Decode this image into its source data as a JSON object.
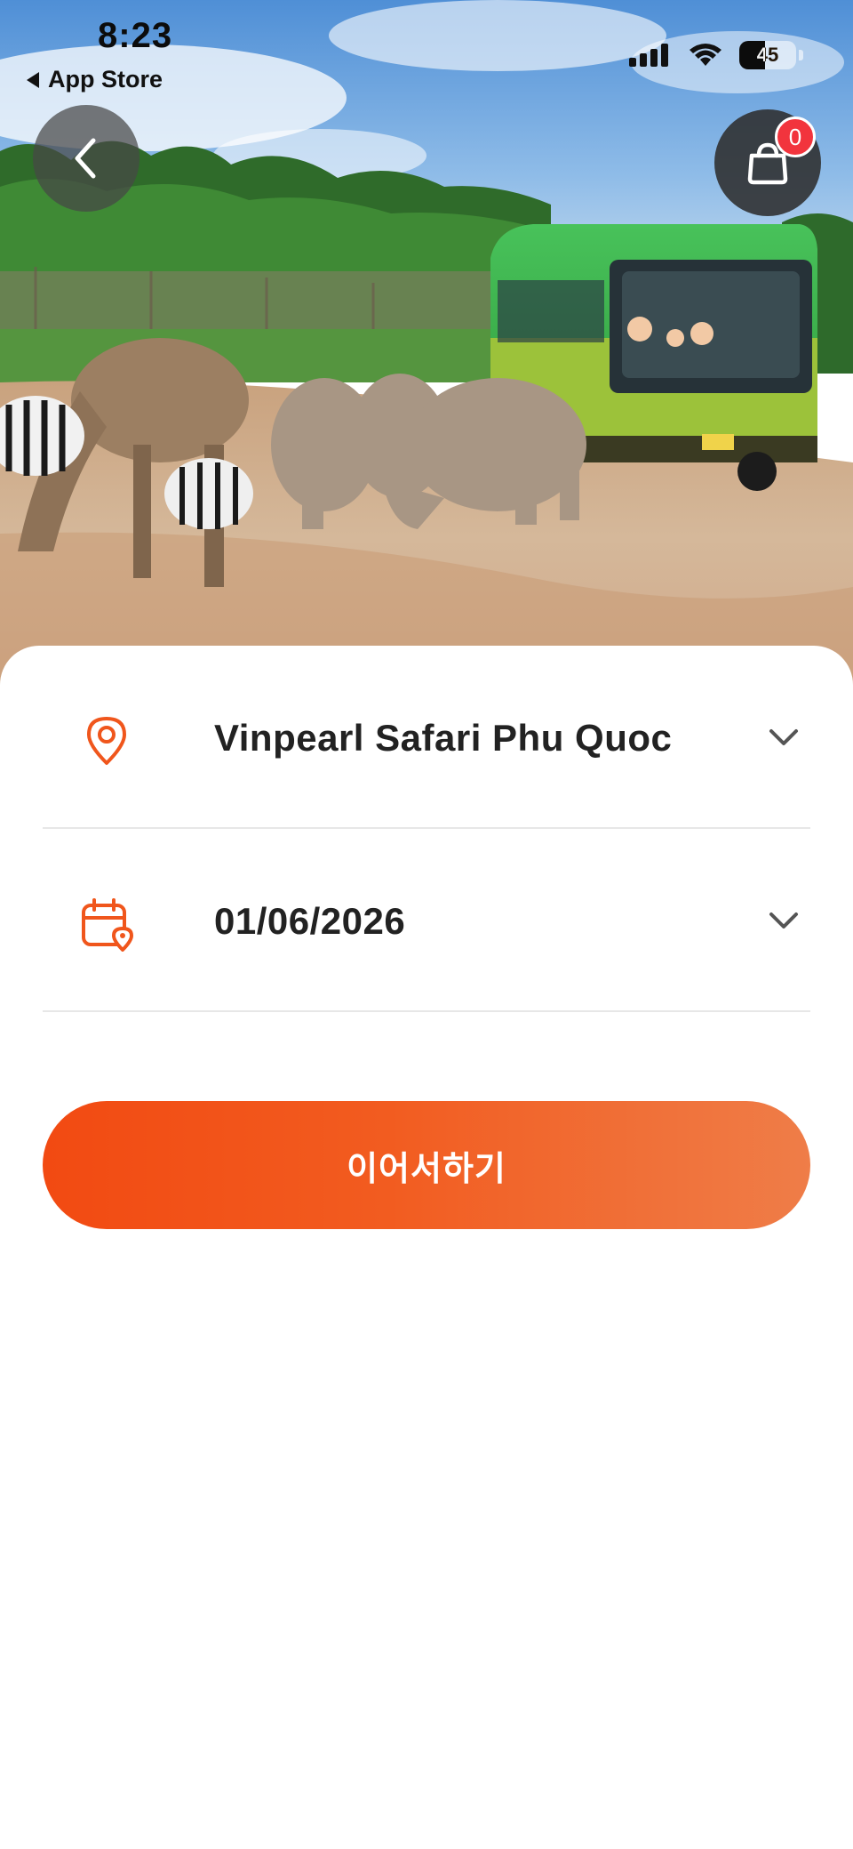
{
  "status_bar": {
    "time": "8:23",
    "back_app": "App Store",
    "battery": "45",
    "battery_level": 0.45
  },
  "header": {
    "cart_count": "0"
  },
  "booking": {
    "location": "Vinpearl Safari Phu Quoc",
    "date": "01/06/2026",
    "continue_label": "이어서하기"
  },
  "colors": {
    "accent": "#F2561C",
    "badge": "#F2343D",
    "text": "#222222"
  },
  "icons": {
    "location": "map-pin-icon",
    "date": "calendar-pin-icon",
    "expand": "chevron-down-icon",
    "back": "chevron-left-icon",
    "cart": "shopping-bag-icon"
  }
}
